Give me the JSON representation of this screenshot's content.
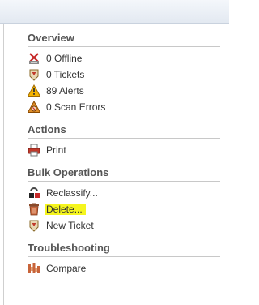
{
  "sections": [
    {
      "title": "Overview",
      "items": [
        {
          "label": "0 Offline",
          "icon": "offline-icon"
        },
        {
          "label": "0 Tickets",
          "icon": "ticket-icon"
        },
        {
          "label": "89 Alerts",
          "icon": "alert-icon"
        },
        {
          "label": "0 Scan Errors",
          "icon": "scan-error-icon"
        }
      ]
    },
    {
      "title": "Actions",
      "items": [
        {
          "label": "Print",
          "icon": "printer-icon"
        }
      ]
    },
    {
      "title": "Bulk Operations",
      "items": [
        {
          "label": "Reclassify...",
          "icon": "reclassify-icon"
        },
        {
          "label": "Delete...",
          "icon": "trash-icon",
          "highlighted": true
        },
        {
          "label": "New Ticket",
          "icon": "new-ticket-icon"
        }
      ]
    },
    {
      "title": "Troubleshooting",
      "items": [
        {
          "label": "Compare",
          "icon": "compare-icon"
        }
      ]
    }
  ],
  "colors": {
    "highlight": "#f5f51e",
    "section_title": "#555555",
    "text": "#333333"
  }
}
